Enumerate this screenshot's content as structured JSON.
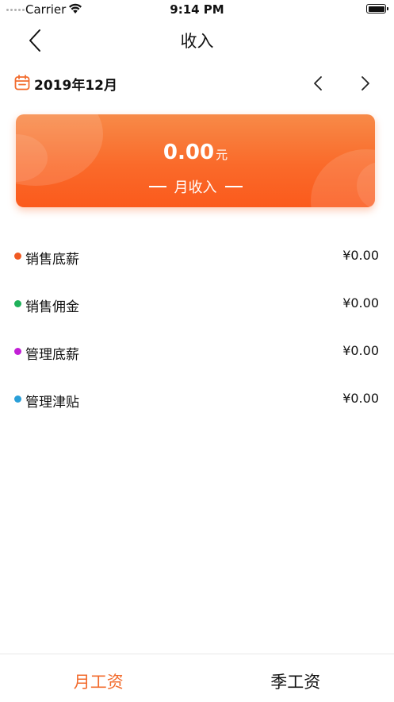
{
  "status_bar": {
    "carrier": "Carrier",
    "time": "9:14 PM",
    "wifi_icon": "wifi-icon",
    "battery_icon": "battery-icon"
  },
  "nav": {
    "title": "收入",
    "back_icon": "chevron-left-icon"
  },
  "month_selector": {
    "label": "2019年12月",
    "calendar_icon": "calendar-icon",
    "prev_icon": "chevron-left-icon",
    "next_icon": "chevron-right-icon",
    "accent_color": "#f26c2e"
  },
  "income_card": {
    "amount": "0.00",
    "unit": "元",
    "subtitle": "月收入",
    "gradient_colors": [
      "#f78a48",
      "#fb5a1c"
    ]
  },
  "income_items": [
    {
      "label": "销售底薪",
      "value": "¥0.00",
      "dot_color": "#f05a23"
    },
    {
      "label": "销售佣金",
      "value": "¥0.00",
      "dot_color": "#1fb15a"
    },
    {
      "label": "管理底薪",
      "value": "¥0.00",
      "dot_color": "#c21fd6"
    },
    {
      "label": "管理津贴",
      "value": "¥0.00",
      "dot_color": "#2a9fd8"
    }
  ],
  "tabs": [
    {
      "label": "月工资",
      "active": true
    },
    {
      "label": "季工资",
      "active": false
    }
  ],
  "colors": {
    "accent": "#f26c2e",
    "text": "#111111"
  }
}
